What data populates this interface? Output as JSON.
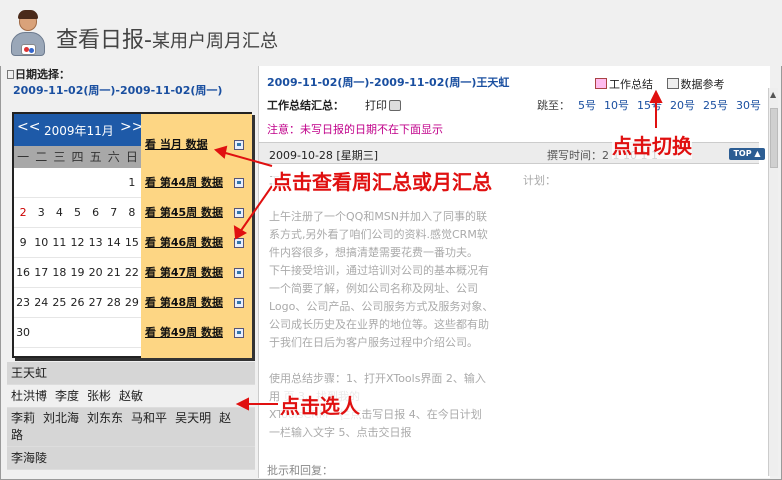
{
  "header": {
    "title": "查看日报-",
    "subtitle": "某用户周月汇总"
  },
  "left": {
    "date_label": "日期选择：",
    "date_range": "2009-11-02(周一)-2009-11-02(周一)",
    "calendar": {
      "prev": "<<",
      "next": ">>",
      "month": "2009年11月",
      "weekdays": [
        "一",
        "二",
        "三",
        "四",
        "五",
        "六",
        "日"
      ],
      "rows": [
        [
          "",
          "",
          "",
          "",
          "",
          "",
          "1"
        ],
        [
          "2",
          "3",
          "4",
          "5",
          "6",
          "7",
          "8"
        ],
        [
          "9",
          "10",
          "11",
          "12",
          "13",
          "14",
          "15"
        ],
        [
          "16",
          "17",
          "18",
          "19",
          "20",
          "21",
          "22"
        ],
        [
          "23",
          "24",
          "25",
          "26",
          "27",
          "28",
          "29"
        ],
        [
          "30",
          "",
          "",
          "",
          "",
          "",
          ""
        ]
      ],
      "month_btn": "看  当月  数据",
      "week_btns": [
        "看  第44周  数据",
        "看  第45周  数据",
        "看  第46周  数据",
        "看  第47周  数据",
        "看  第48周  数据",
        "看  第49周  数据"
      ]
    },
    "people": [
      [
        "王天虹"
      ],
      [
        "杜洪博",
        "李度",
        "张彬",
        "赵敏"
      ],
      [
        "李莉",
        "刘北海",
        "刘东东",
        "马和平",
        "吴天明",
        "赵"
      ],
      [
        "路"
      ],
      [
        "李海陵"
      ]
    ]
  },
  "right": {
    "title": "2009-11-02(周一)-2009-11-02(周一)王天虹",
    "tab_summary": "工作总结",
    "tab_reference": "数据参考",
    "summary_label": "工作总结汇总：",
    "print": "打印",
    "jump_label": "跳至：",
    "jump_items": [
      "5号",
      "10号",
      "15号",
      "20号",
      "25号",
      "30号"
    ],
    "note": "注意：未写日报的日期不在下面显示",
    "entry_date": "2009-10-28 [星期三]",
    "entry_time": "撰写时间：2  1   10   1   1",
    "top_btn": "TOP",
    "plan_label": "计划：",
    "body": "工\n\n上午注册了一个QQ和MSN并加入了同事的联\n系方式,另外看了咱们公司的资料.感觉CRM软\n件内容很多，想搞清楚需要花费一番功夫。\n下午接受培训，通过培训对公司的基本概况有\n一个简要了解，例如公司名称及网址、公司\nLogo、公司产品、公司服务方式及服务对象、\n公司成长历史及在业界的地位等。这些都有助\n于我们在日后为客户服务过程中介绍公司。\n\n使用总结步骤：1、打开XTools界面  2、输入\n用          页  3、找到我的\nXToolsCRM一栏点击写日报  4、在今日计划\n一栏输入文字  5、点击交日报",
    "reply": "批示和回复："
  },
  "annotations": {
    "a1": "点击查看周汇总或月汇总",
    "a2": "点击切换",
    "a3": "点击选人"
  },
  "colors": {
    "accent": "#1a4fa0",
    "annotation": "#e01010",
    "calendar_header": "#1e5aa8",
    "week_column": "#fdd684"
  }
}
